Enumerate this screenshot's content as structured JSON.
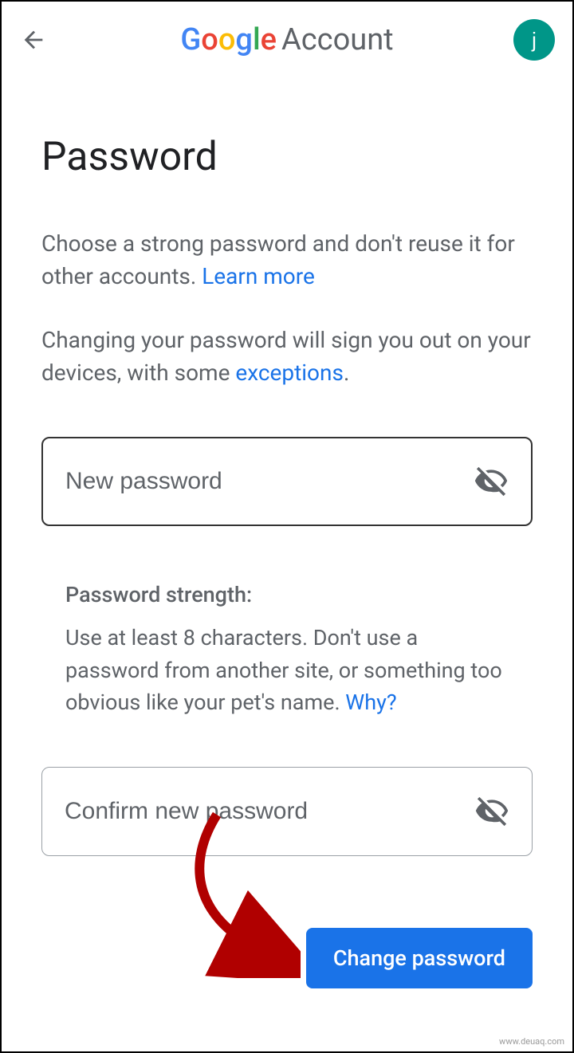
{
  "header": {
    "logo_letters": [
      "G",
      "o",
      "o",
      "g",
      "l",
      "e"
    ],
    "account_word": "Account",
    "avatar_letter": "j"
  },
  "page": {
    "title": "Password",
    "desc1_a": "Choose a strong password and don't reuse it for other accounts. ",
    "learn_more": "Learn more",
    "desc2_a": "Changing your password will sign you out on your devices, with some ",
    "exceptions": "exceptions",
    "desc2_b": "."
  },
  "inputs": {
    "new_placeholder": "New password",
    "confirm_placeholder": "Confirm new password"
  },
  "strength": {
    "title": "Password strength:",
    "desc_a": "Use at least 8 characters. Don't use a password from another site, or something too obvious like your pet's name. ",
    "why": "Why?"
  },
  "button": {
    "change": "Change password"
  },
  "watermark": "www.deuaq.com"
}
